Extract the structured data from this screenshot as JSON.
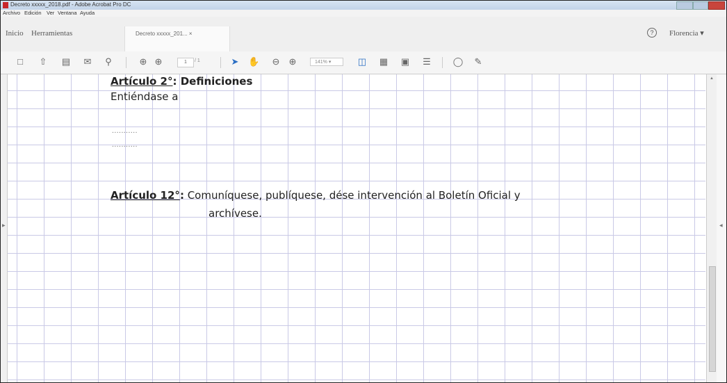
{
  "window": {
    "title": "Decreto xxxxx_2018.pdf - Adobe Acrobat Pro DC"
  },
  "menu": [
    "Archivo",
    "Edición",
    "Ver",
    "Ventana",
    "Ayuda"
  ],
  "tabs": {
    "home": "Inicio",
    "tools": "Herramientas",
    "document": "Decreto xxxxx_201... ×"
  },
  "user": {
    "name": "Florencia ▾"
  },
  "toolbar": {
    "page_current": "1",
    "page_total": "/ 1",
    "zoom": "141% ▾",
    "icons": [
      "save-icon",
      "upload-icon",
      "print-icon",
      "email-icon",
      "search-icon",
      "page-up-icon",
      "page-down-icon",
      "select-arrow-icon",
      "hand-icon",
      "zoom-out-icon",
      "zoom-in-icon",
      "fit-page-icon",
      "page-view-icon",
      "fullscreen-icon",
      "sign-icon",
      "comment-icon",
      "highlight-pen-icon"
    ],
    "accent": "#2b6fc4"
  },
  "document": {
    "art2_label": "Artículo 2°",
    "art2_title": ": Definiciones",
    "entiendase": "Entiéndase a",
    "dots1": "...........",
    "dots2": "...........",
    "art12_label": "Artículo 12°",
    "art12_colon": ":",
    "art12_text": " Comuníquese, publíquese, dése intervención al Boletín Oficial y",
    "art12_cont": "archívese."
  },
  "grid_color": "#c9c9e6"
}
